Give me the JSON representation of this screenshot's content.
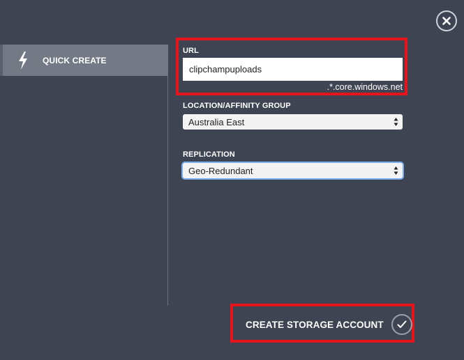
{
  "nav": {
    "items": [
      {
        "label": "QUICK CREATE",
        "icon": "lightning-bolt-icon",
        "selected": true
      }
    ]
  },
  "form": {
    "url": {
      "label": "URL",
      "value": "clipchampuploads",
      "suffix": ".*.core.windows.net"
    },
    "location": {
      "label": "LOCATION/AFFINITY GROUP",
      "selected": "Australia East"
    },
    "replication": {
      "label": "REPLICATION",
      "selected": "Geo-Redundant"
    }
  },
  "actions": {
    "create_label": "CREATE STORAGE ACCOUNT",
    "create_icon": "checkmark-icon",
    "close_icon": "close-icon"
  },
  "colors": {
    "background": "#3e4452",
    "nav_selected": "#737a86",
    "highlight": "#e8141b",
    "focus_ring": "#78aef0"
  }
}
